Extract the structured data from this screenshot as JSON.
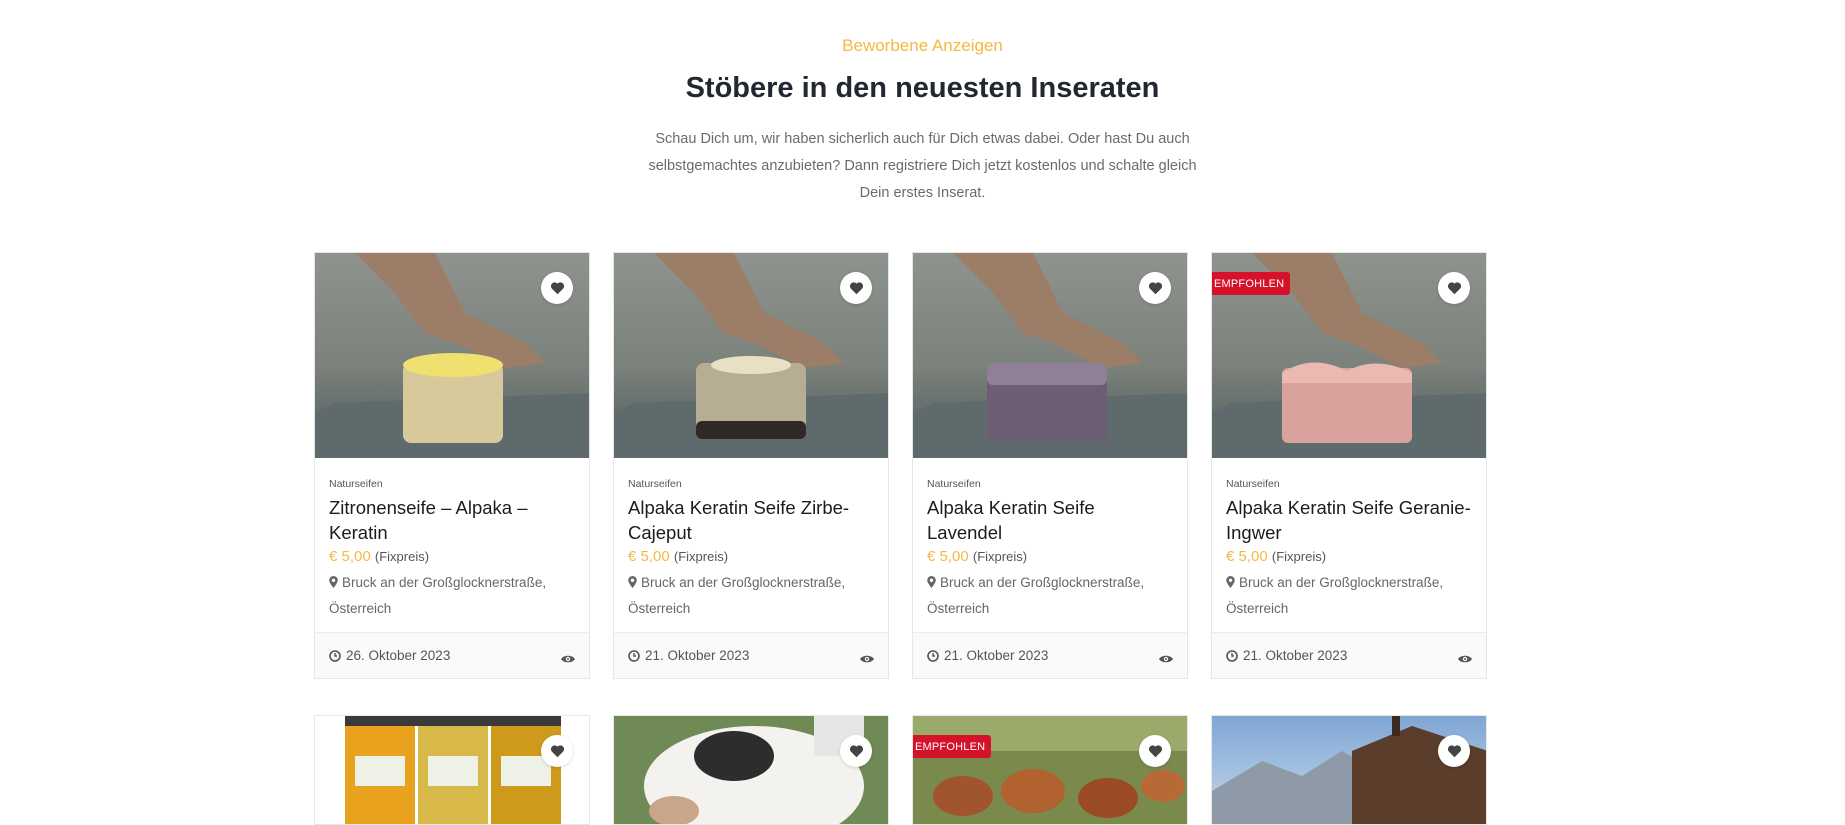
{
  "section": {
    "eyebrow": "Beworbene Anzeigen",
    "title": "Stöbere in den neuesten Inseraten",
    "lead": "Schau Dich um, wir haben sicherlich auch für Dich etwas dabei. Oder hast Du auch selbstgemachtes anzubieten? Dann registriere Dich jetzt kostenlos und schalte gleich Dein erstes Inserat."
  },
  "cards": [
    {
      "category": "Naturseifen",
      "title": "Zitronenseife – Alpaka – Keratin",
      "price": "€ 5,00",
      "price_type": "(Fixpreis)",
      "location": "Bruck an der Großglocknerstraße, Österreich",
      "date": "26. Oktober 2023",
      "badge": ""
    },
    {
      "category": "Naturseifen",
      "title": "Alpaka Keratin Seife Zirbe-Cajeput",
      "price": "€ 5,00",
      "price_type": "(Fixpreis)",
      "location": "Bruck an der Großglocknerstraße, Österreich",
      "date": "21. Oktober 2023",
      "badge": ""
    },
    {
      "category": "Naturseifen",
      "title": "Alpaka Keratin Seife Lavendel",
      "price": "€ 5,00",
      "price_type": "(Fixpreis)",
      "location": "Bruck an der Großglocknerstraße, Österreich",
      "date": "21. Oktober 2023",
      "badge": ""
    },
    {
      "category": "Naturseifen",
      "title": "Alpaka Keratin Seife Geranie-Ingwer",
      "price": "€ 5,00",
      "price_type": "(Fixpreis)",
      "location": "Bruck an der Großglocknerstraße, Österreich",
      "date": "21. Oktober 2023",
      "badge": "EMPFOHLEN"
    }
  ],
  "row2": [
    {
      "badge": ""
    },
    {
      "badge": ""
    },
    {
      "badge": "EMPFOHLEN"
    },
    {
      "badge": ""
    }
  ],
  "icons": {
    "favorite": "heart-icon",
    "location": "map-pin-icon",
    "date": "clock-icon",
    "views": "eye-icon"
  },
  "colors": {
    "accent": "#f5b942",
    "badge": "#d6112a",
    "title": "#222831"
  }
}
